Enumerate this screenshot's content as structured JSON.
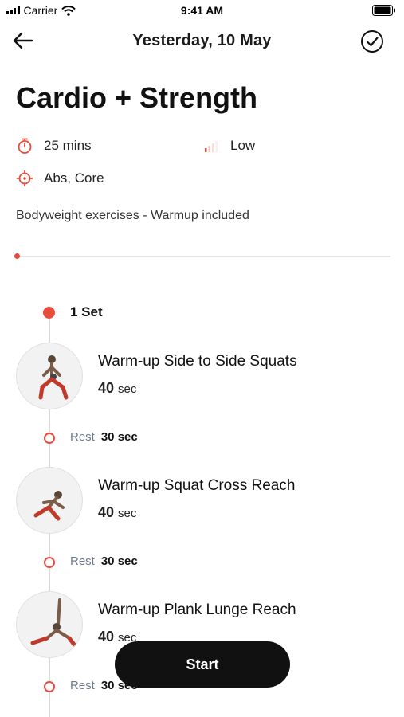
{
  "status_bar": {
    "carrier": "Carrier",
    "time": "9:41 AM"
  },
  "header": {
    "title": "Yesterday, 10 May",
    "back_icon": "arrow-left-icon",
    "done_icon": "check-circle-icon"
  },
  "workout": {
    "title": "Cardio + Strength",
    "duration": "25 mins",
    "intensity": "Low",
    "focus": "Abs, Core",
    "description": "Bodyweight exercises - Warmup included"
  },
  "set": {
    "label": "1 Set"
  },
  "exercises": [
    {
      "name": "Warm-up Side to Side Squats",
      "duration_value": "40",
      "duration_unit": "sec"
    },
    {
      "name": "Warm-up Squat Cross Reach",
      "duration_value": "40",
      "duration_unit": "sec"
    },
    {
      "name": "Warm-up Plank Lunge Reach",
      "duration_value": "40",
      "duration_unit": "sec"
    }
  ],
  "rests": [
    {
      "label": "Rest",
      "value": "30 sec"
    },
    {
      "label": "Rest",
      "value": "30 sec"
    },
    {
      "label": "Rest",
      "value": "30 sec"
    }
  ],
  "start_button": {
    "label": "Start"
  },
  "colors": {
    "accent": "#e74c3c",
    "button": "#111111",
    "muted": "#6d7a8b"
  }
}
